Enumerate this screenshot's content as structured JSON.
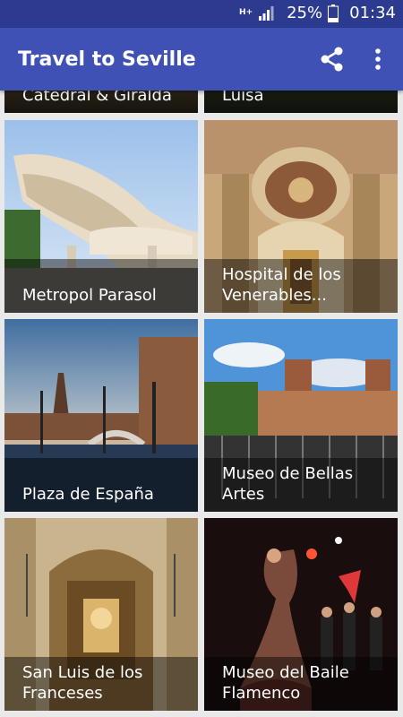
{
  "status": {
    "network": "H+",
    "battery": "25%",
    "time": "01:34"
  },
  "app_bar": {
    "title": "Travel to Seville",
    "share_icon": "share-icon",
    "more_icon": "more-vertical-icon"
  },
  "tiles": [
    {
      "label": "Catedral & Giralda"
    },
    {
      "label": "Luisa"
    },
    {
      "label": "Metropol Parasol"
    },
    {
      "label": "Hospital de los Venerables..."
    },
    {
      "label": "Plaza de España"
    },
    {
      "label": "Museo de Bellas Artes"
    },
    {
      "label": "San Luis de los Franceses"
    },
    {
      "label": "Museo del Baile Flamenco"
    }
  ],
  "colors": {
    "primary": "#3f51b5",
    "primary_dark": "#2c3b8f"
  }
}
